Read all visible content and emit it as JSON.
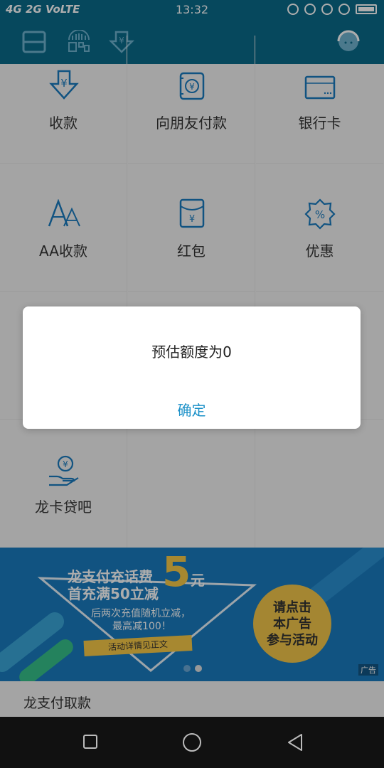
{
  "status_bar": {
    "network": "4G 2G VoLTE",
    "time": "13:32"
  },
  "toolbar": {
    "icons": [
      "scan-icon",
      "barcode-icon",
      "yuan-down-icon",
      "customer-service-icon"
    ]
  },
  "grid": {
    "items": [
      {
        "label": "收款",
        "icon": "receive-money-icon"
      },
      {
        "label": "向朋友付款",
        "icon": "pay-friend-icon"
      },
      {
        "label": "银行卡",
        "icon": "bank-card-icon"
      },
      {
        "label": "AA收款",
        "icon": "aa-icon"
      },
      {
        "label": "红包",
        "icon": "red-packet-icon"
      },
      {
        "label": "优惠",
        "icon": "discount-icon"
      },
      {
        "label": "龙卡贷吧",
        "icon": "loan-icon"
      }
    ]
  },
  "banner": {
    "line1": "龙支付充话费",
    "line2": "首充满50立减",
    "amount": "5",
    "unit": "元",
    "line3": "后两次充值随机立减，",
    "line4": "最高减100！",
    "tag": "活动详情见正文",
    "circle_lines": [
      "请点击",
      "本广告",
      "参与活动"
    ],
    "ad_label": "广告",
    "colors": {
      "background": "#1a7bbf",
      "accent": "#f7c948"
    }
  },
  "section": {
    "title": "龙支付取款"
  },
  "dialog": {
    "message": "预估额度为0",
    "confirm_label": "确定"
  },
  "colors": {
    "header": "#0a6a8a",
    "icon": "#1a7bbf",
    "confirm": "#1a90c8"
  }
}
